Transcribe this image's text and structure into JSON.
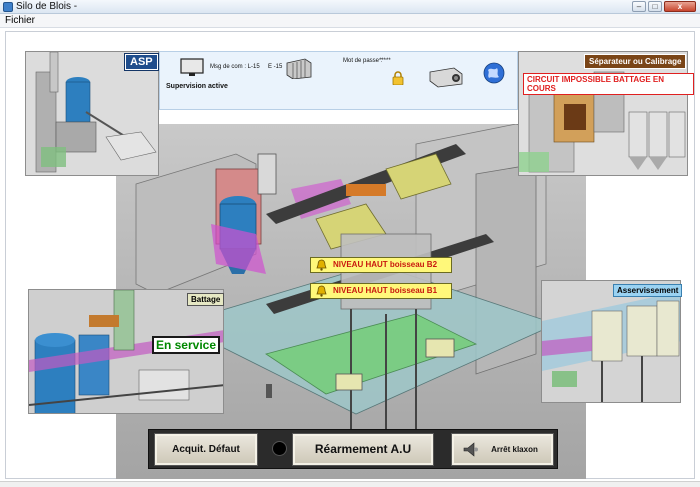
{
  "window": {
    "title": "Silo de Blois -",
    "controls": {
      "minimize": "–",
      "maximize": "□",
      "close": "x"
    }
  },
  "menu": {
    "items": [
      "Fichier"
    ]
  },
  "supervision": {
    "msg_label": "Msg de com  : L",
    "msg_l_value": "-15",
    "msg_e_value": "E  -15",
    "password_label": "Mot de passe :",
    "password_value": "*****",
    "status": "Supervision active"
  },
  "scenes": {
    "asp": {
      "label": "ASP"
    },
    "separateur": {
      "label": "Séparateur ou Calibrage",
      "warning": "CIRCUIT IMPOSSIBLE BATTAGE EN COURS"
    },
    "battage": {
      "label": "Battage",
      "state": "En service"
    },
    "asservissement": {
      "label": "Asservissement"
    }
  },
  "alarms": [
    {
      "text": "NIVEAU HAUT boisseau B2"
    },
    {
      "text": "NIVEAU HAUT boisseau B1"
    }
  ],
  "controls": {
    "acquit": "Acquit. Défaut",
    "rearm": "Réarmement  A.U",
    "klaxon": "Arrêt klaxon"
  },
  "colors": {
    "alarm_bg": "#fff87a",
    "alarm_text": "#c8170f",
    "en_service_text": "#008800",
    "asp_tag": "#1f4d8c",
    "separateur_tag": "#7a4517",
    "asservissement_tag": "#9ad2f2"
  }
}
